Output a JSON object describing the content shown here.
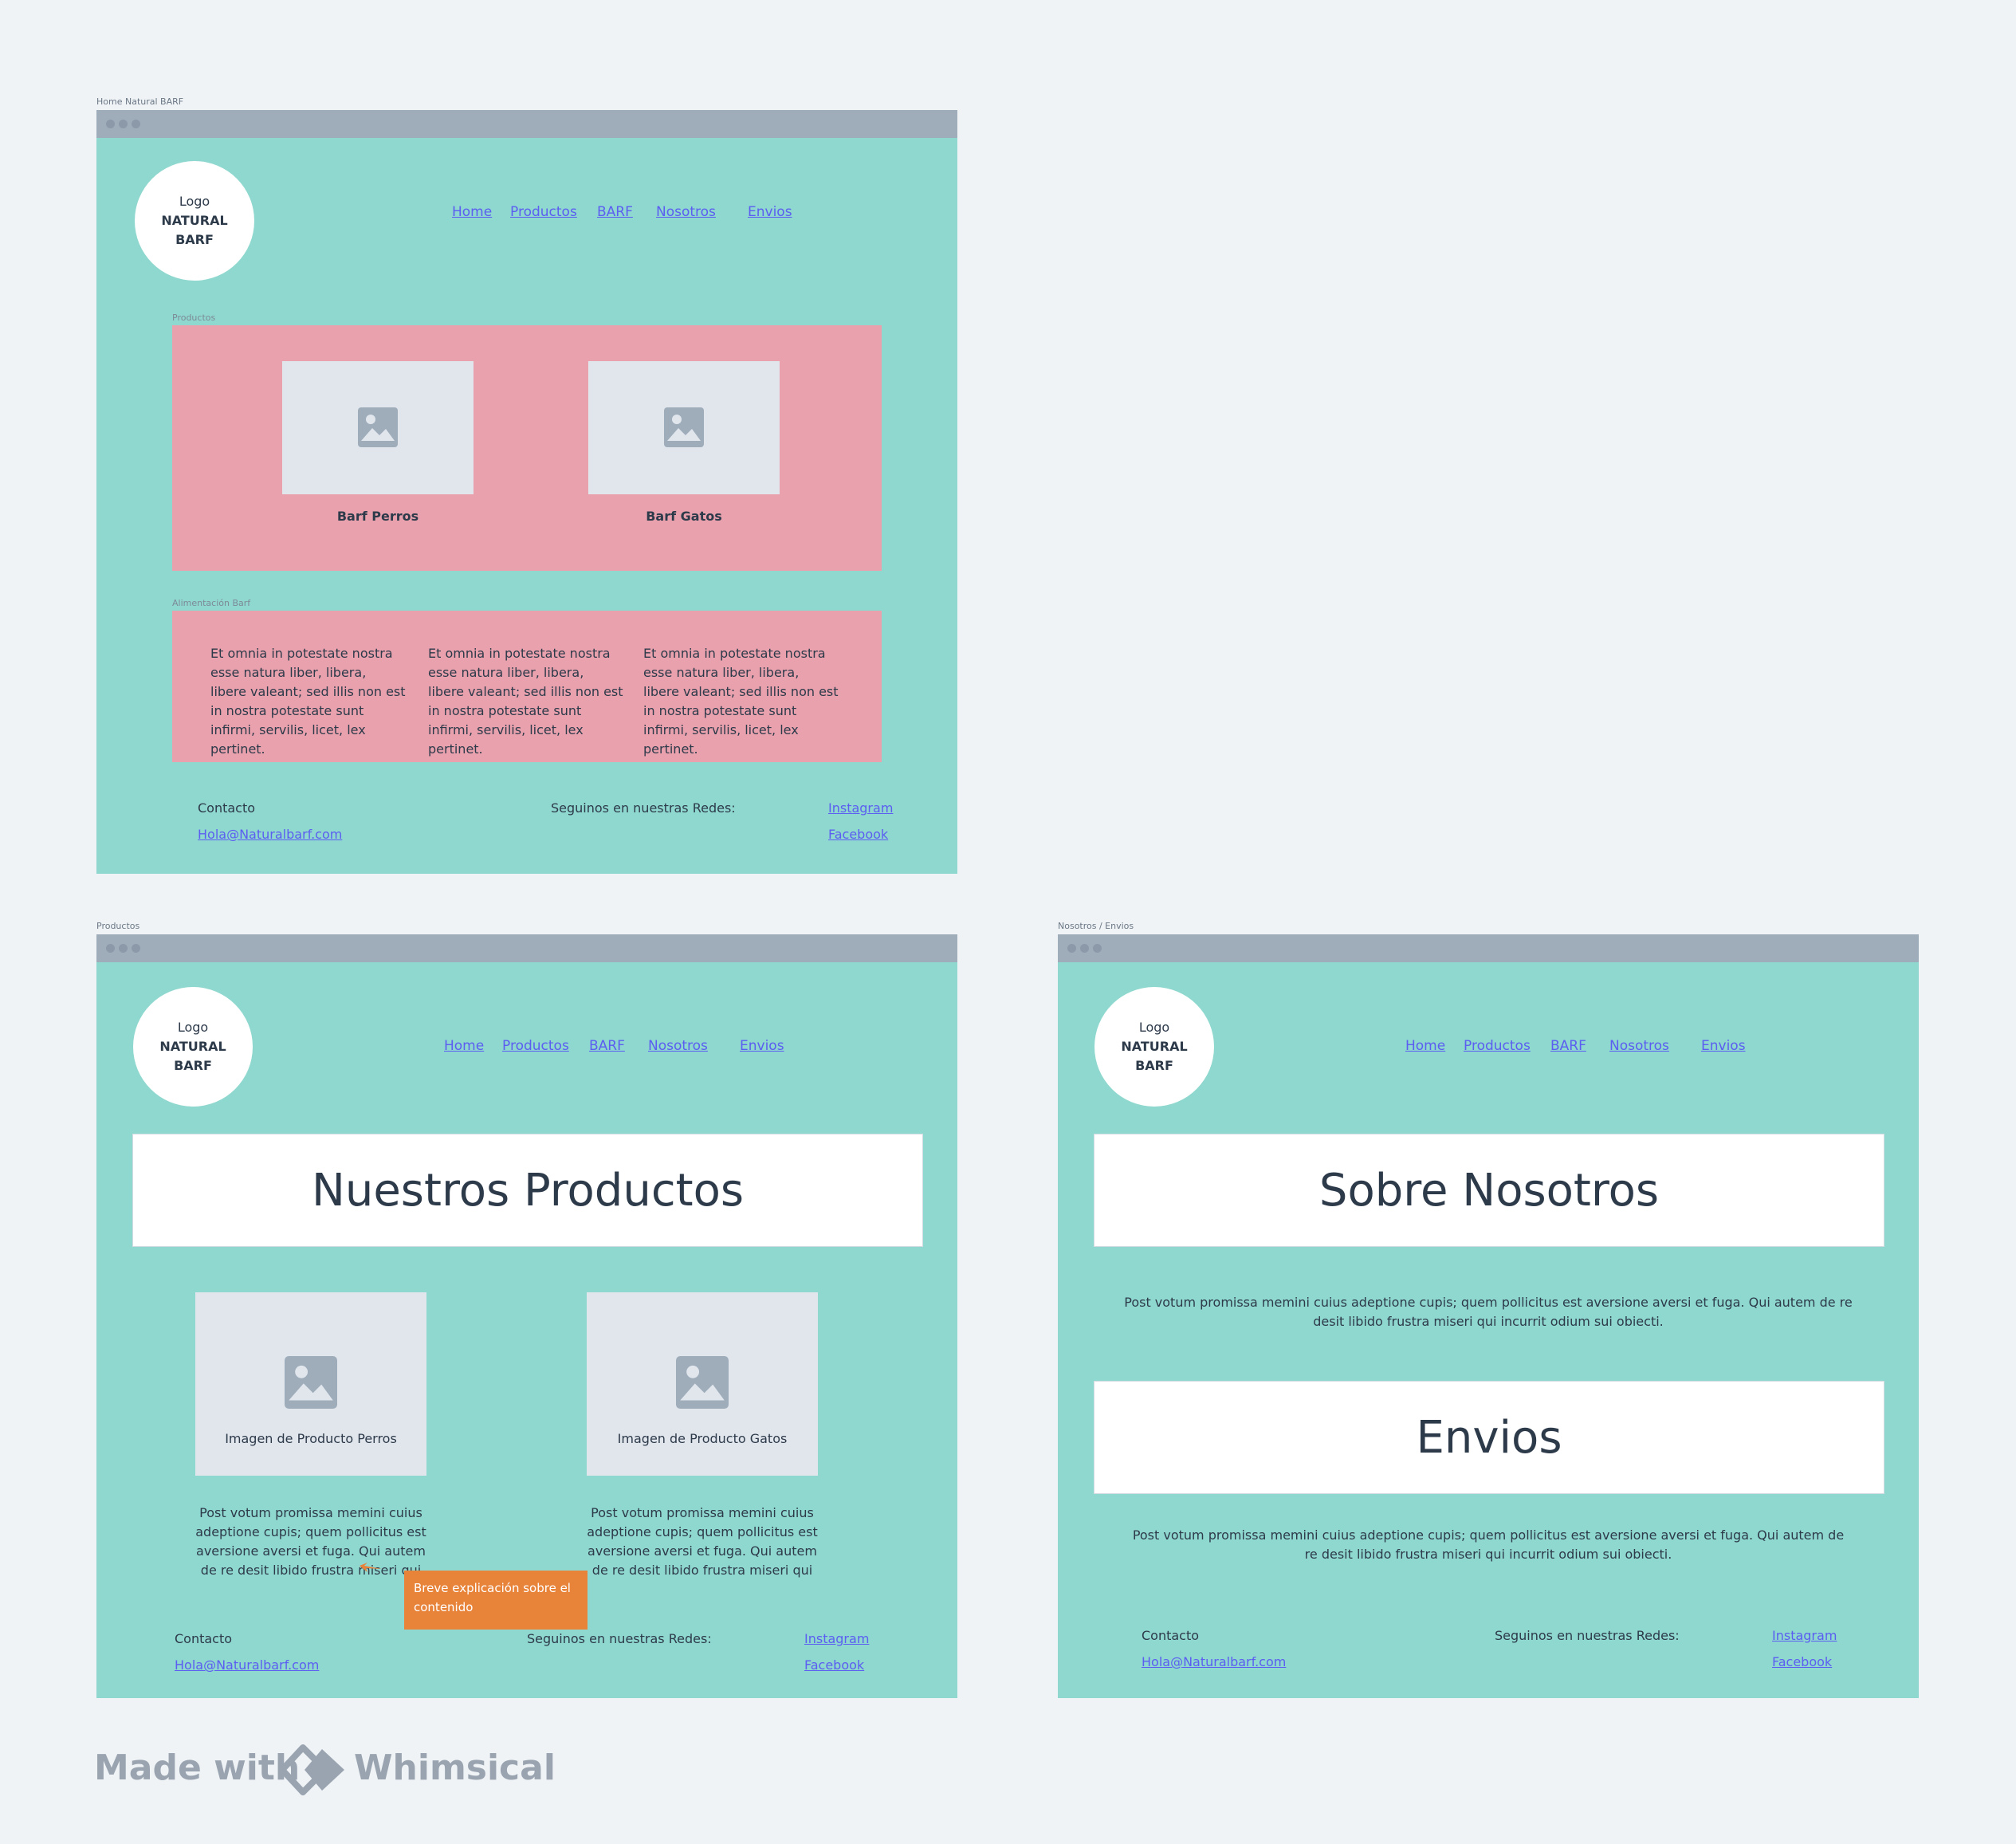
{
  "frames": {
    "home": {
      "label": "Home Natural BARF"
    },
    "productos": {
      "label": "Productos"
    },
    "nosotros": {
      "label": "Nosotros / Envios"
    }
  },
  "logo": {
    "line1": "Logo",
    "line2": "NATURAL",
    "line3": "BARF"
  },
  "nav": {
    "home": "Home",
    "productos": "Productos",
    "barf": "BARF",
    "nosotros": "Nosotros",
    "envios": "Envios"
  },
  "home": {
    "productos_label": "Productos",
    "card1": "Barf Perros",
    "card2": "Barf Gatos",
    "alimentacion_label": "Alimentación Barf",
    "col_text": "Et omnia in potestate nostra esse natura liber, libera, libere valeant; sed illis non est in nostra potestate sunt infirmi, servilis, licet, lex pertinet."
  },
  "footer": {
    "contacto": "Contacto",
    "email": "Hola@Naturalbarf.com",
    "redes": "Seguinos en nuestras Redes:",
    "instagram": "Instagram",
    "facebook": "Facebook"
  },
  "productos": {
    "title": "Nuestros Productos",
    "img1": "Imagen de Producto Perros",
    "img2": "Imagen de Producto Gatos",
    "desc": "Post votum promissa memini cuius adeptione cupis; quem pollicitus est aversione aversi et fuga. Qui autem de re desit libido frustra miseri qui",
    "callout": "Breve explicación sobre el contenido"
  },
  "nosotros": {
    "title": "Sobre Nosotros",
    "text1": "Post votum promissa memini cuius adeptione cupis; quem pollicitus est aversione aversi et fuga. Qui autem de re desit libido frustra miseri qui incurrit odium sui obiecti.",
    "envios_title": "Envios",
    "text2": "Post votum promissa memini cuius adeptione cupis; quem pollicitus est aversione aversi et fuga. Qui autem de re desit libido frustra miseri qui incurrit odium sui obiecti."
  },
  "brand": {
    "made_with": "Made with",
    "name": "Whimsical"
  },
  "colors": {
    "window_bg": "#8fd8cf",
    "pink": "#e9a1ad",
    "link": "#5b5ef0",
    "callout": "#e8833a"
  }
}
